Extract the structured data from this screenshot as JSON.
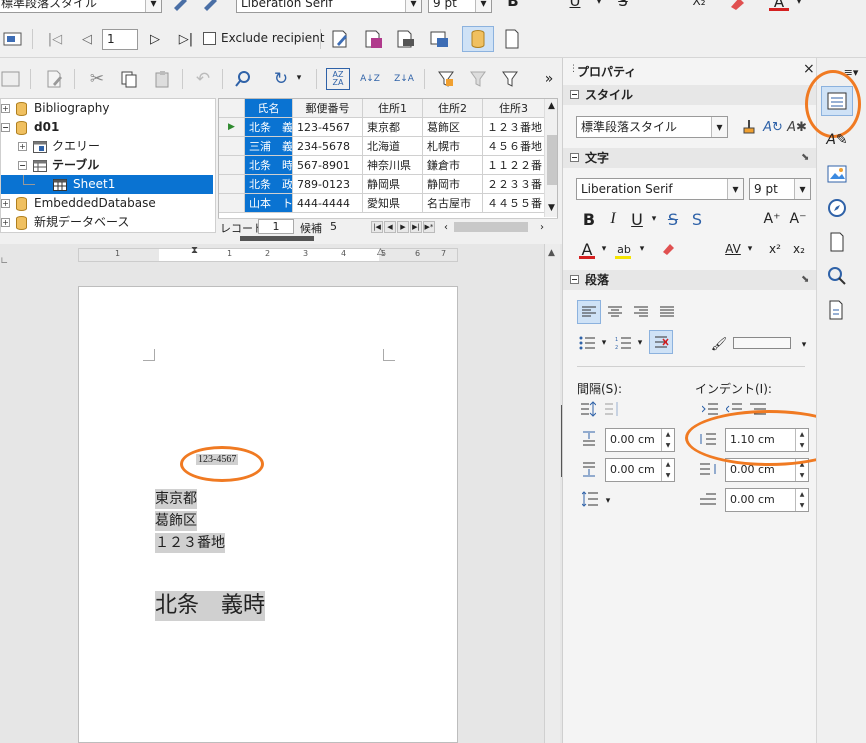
{
  "toolbar1": {
    "paragraph_style": "標準段落スタイル",
    "font_name": "Liberation Serif",
    "font_size": "9 pt",
    "bold": "B",
    "underline": "U",
    "strike": "S",
    "subscript": "X₂"
  },
  "toolbar2": {
    "record_number": "1",
    "exclude_recipient": "Exclude recipient"
  },
  "tree": {
    "items": [
      {
        "label": "Bibliography",
        "level": 0
      },
      {
        "label": "d01",
        "level": 0
      },
      {
        "label": "クエリー",
        "level": 1
      },
      {
        "label": "テーブル",
        "level": 1
      },
      {
        "label": "Sheet1",
        "level": 2,
        "selected": true
      },
      {
        "label": "EmbeddedDatabase",
        "level": 0
      },
      {
        "label": "新規データベース",
        "level": 0
      }
    ]
  },
  "grid": {
    "headers": [
      "氏名",
      "郵便番号",
      "住所1",
      "住所2",
      "住所3"
    ],
    "rows": [
      [
        "北条　義",
        "123-4567",
        "東京都",
        "葛飾区",
        "１２３番地"
      ],
      [
        "三浦　義",
        "234-5678",
        "北海道",
        "札幌市",
        "４５６番地"
      ],
      [
        "北条　時",
        "567-8901",
        "神奈川県",
        "鎌倉市",
        "１１２２番"
      ],
      [
        "北条　政",
        "789-0123",
        "静岡県",
        "静岡市",
        "２２３３番"
      ],
      [
        "山本　ト",
        "444-4444",
        "愛知県",
        "名古屋市",
        "４４５５番"
      ]
    ],
    "record_label": "レコード",
    "record_value": "1",
    "candidate_label": "候補",
    "candidate_value": "5"
  },
  "ruler": {
    "marks": [
      "1",
      "1",
      "2",
      "3",
      "4",
      "5",
      "6",
      "7"
    ]
  },
  "document": {
    "postal": "123-4567",
    "addr1": "東京都",
    "addr2": "葛飾区",
    "addr3": "１２３番地",
    "name": "北条　義時"
  },
  "sidebar": {
    "title": "プロパティ",
    "style_section": "スタイル",
    "style_value": "標準段落スタイル",
    "char_section": "文字",
    "font_value": "Liberation Serif",
    "size_value": "9 pt",
    "para_section": "段落",
    "spacing_label": "間隔(S):",
    "indent_label": "インデント(I):",
    "above_spacing": "0.00 cm",
    "below_spacing": "0.00 cm",
    "indent_before": "1.10 cm",
    "indent_after": "0.00 cm",
    "first_line": "0.00 cm"
  },
  "colors": {
    "accent": "#0a73d2",
    "highlight_ring": "#f07a22",
    "font_color": "#d42020"
  }
}
